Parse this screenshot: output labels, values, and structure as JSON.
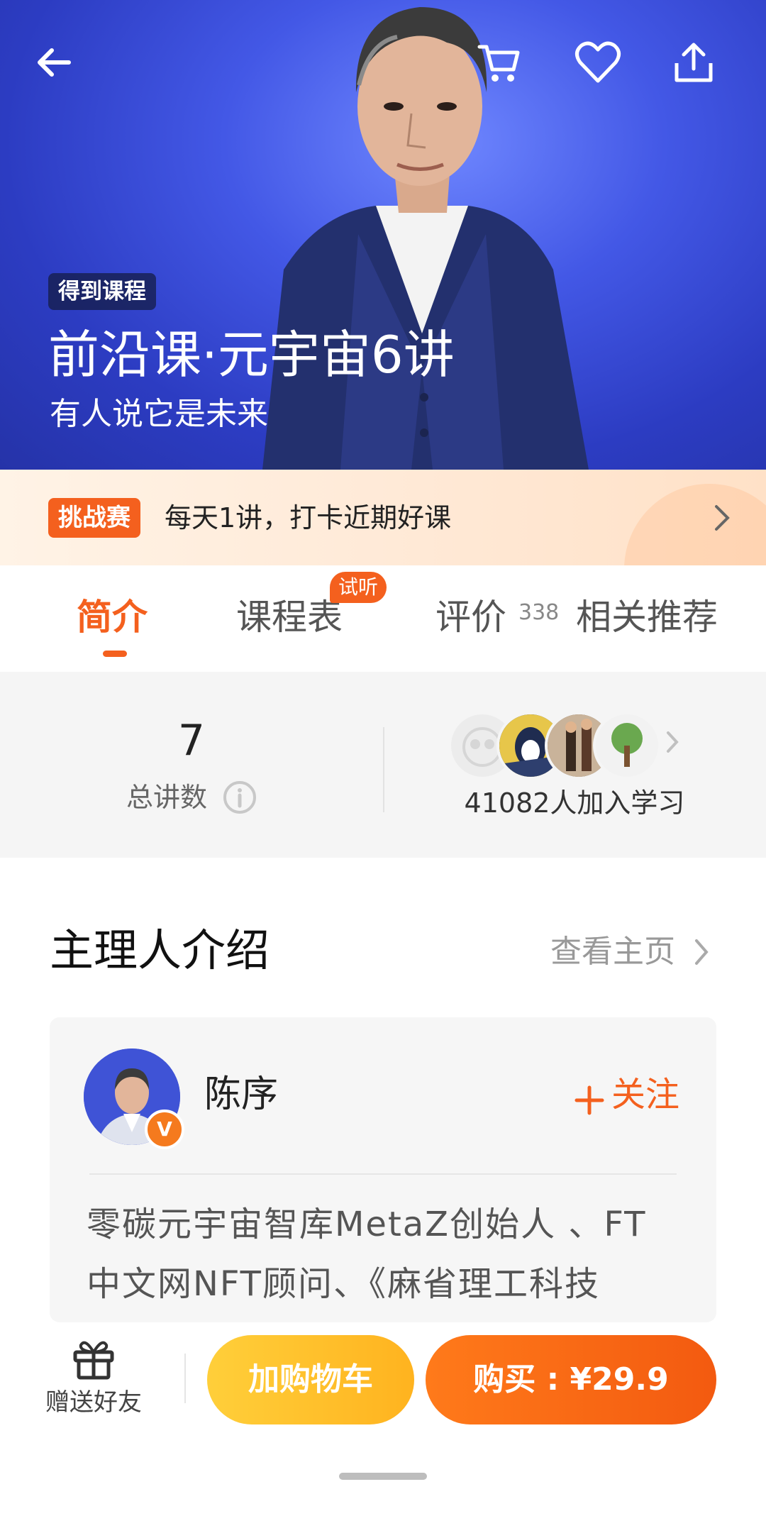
{
  "hero": {
    "tag": "得到课程",
    "title": "前沿课·元宇宙6讲",
    "subtitle": "有人说它是未来",
    "icons": [
      "back-arrow-icon",
      "cart-icon",
      "heart-icon",
      "share-icon"
    ],
    "background_color": "#3a4ddb"
  },
  "challenge": {
    "badge": "挑战赛",
    "text": "每天1讲，打卡近期好课"
  },
  "tabs": {
    "items": [
      {
        "label": "简介",
        "active": true
      },
      {
        "label": "课程表",
        "badge": "试听"
      },
      {
        "label": "评价",
        "count": "338"
      },
      {
        "label": "相关推荐"
      }
    ]
  },
  "stats": {
    "lectures_count": "7",
    "lectures_label": "总讲数",
    "learners": "41082人加入学习"
  },
  "instructor": {
    "section_title": "主理人介绍",
    "view_home": "查看主页",
    "name": "陈序",
    "verified_badge": "V",
    "follow": "关注",
    "description_line1": "零碳元宇宙智库MetaZ创始人 、FT",
    "description_line2": "中文网NFT顾问、《麻省理工科技"
  },
  "bottom_bar": {
    "gift_label": "赠送好友",
    "add_to_cart": "加购物车",
    "buy": "购买 : ¥29.9"
  },
  "colors": {
    "accent": "#f4601e",
    "cart_button": "#ffbd2a",
    "buy_button": "#f96a14"
  }
}
